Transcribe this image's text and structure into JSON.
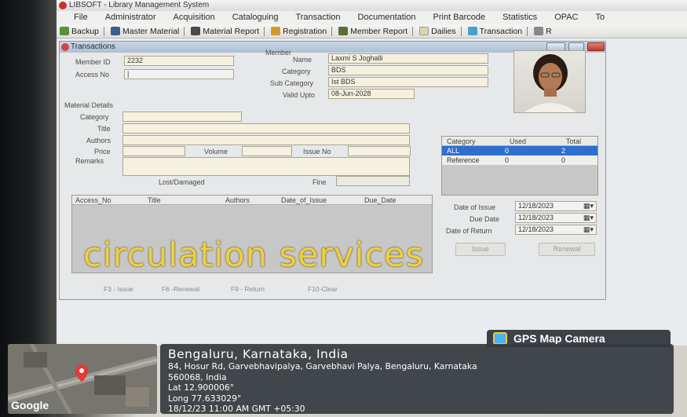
{
  "app": {
    "title": "LIBSOFT - Library Management System",
    "menu": [
      "File",
      "Administrator",
      "Acquisition",
      "Cataloguing",
      "Transaction",
      "Documentation",
      "Print Barcode",
      "Statistics",
      "OPAC",
      "To"
    ],
    "toolbar": [
      {
        "label": "Backup",
        "icon": "backup-icon",
        "color": "#5b8f3a"
      },
      {
        "label": "Master Material",
        "icon": "master-material-icon",
        "color": "#3b5f8c"
      },
      {
        "label": "Material Report",
        "icon": "binoculars-icon",
        "color": "#4a4a4a"
      },
      {
        "label": "Registration",
        "icon": "registration-icon",
        "color": "#d19a2b"
      },
      {
        "label": "Member Report",
        "icon": "members-icon",
        "color": "#5a6d3a"
      },
      {
        "label": "Dailies",
        "icon": "dailies-icon",
        "color": "#d8d6b2"
      },
      {
        "label": "Transaction",
        "icon": "transaction-icon",
        "color": "#4aa0c8"
      },
      {
        "label": "R",
        "icon": "report-icon",
        "color": "#888888"
      }
    ]
  },
  "window": {
    "title": "Transactions",
    "member_section": "Member",
    "member_id_label": "Member ID",
    "member_id": "2232",
    "access_no_label": "Access No",
    "access_no": "|",
    "name_label": "Name",
    "name": "Laxmi S Joghalli",
    "category_label": "Category",
    "category": "BDS",
    "sub_category_label": "Sub Category",
    "sub_category": "Ist BDS",
    "valid_upto_label": "Valid Upto",
    "valid_upto": "08-Jun-2028",
    "material_details_label": "Material Details",
    "m_category_label": "Category",
    "m_title_label": "Title",
    "m_authors_label": "Authors",
    "m_price_label": "Price",
    "m_volume_label": "Volume",
    "m_issue_no_label": "Issue No",
    "m_remarks_label": "Remarks",
    "lost_damaged_label": "Lost/Damaged",
    "fine_label": "Fine",
    "issued_columns": [
      "Access_No",
      "Title",
      "Authors",
      "Date_of_Issue",
      "Due_Date"
    ],
    "limits": {
      "columns": [
        "Category",
        "Used",
        "Total"
      ],
      "rows": [
        {
          "category": "ALL",
          "used": "0",
          "total": "2"
        },
        {
          "category": "Reference",
          "used": "0",
          "total": "0"
        }
      ]
    },
    "date_of_issue_label": "Date of Issue",
    "date_of_issue": "12/18/2023",
    "due_date_label": "Due Date",
    "due_date": "12/18/2023",
    "date_of_return_label": "Date of Return",
    "date_of_return": "12/18/2023",
    "buttons": [
      "Issue",
      "Renewal"
    ],
    "fkeys": [
      "F3 - Issue",
      "F6 -Renewal",
      "F9 - Return",
      "F10-Clear"
    ]
  },
  "overlay": {
    "watermark": "circulation services",
    "gps_badge": "GPS Map Camera",
    "city": "Bengaluru, Karnataka, India",
    "address_line1": "84, Hosur Rd, Garvebhavipalya, Garvebhavi Palya, Bengaluru, Karnataka",
    "address_line2": "560068, India",
    "lat": "Lat 12.900006°",
    "long": "Long 77.633029°",
    "timestamp": "18/12/23 11:00 AM GMT +05:30",
    "map_brand": "Google"
  },
  "colors": {
    "selection": "#2d6fd1",
    "watermark": "#f2cf3c",
    "gps_panel": "#343a40",
    "map_pin": "#e53935"
  }
}
